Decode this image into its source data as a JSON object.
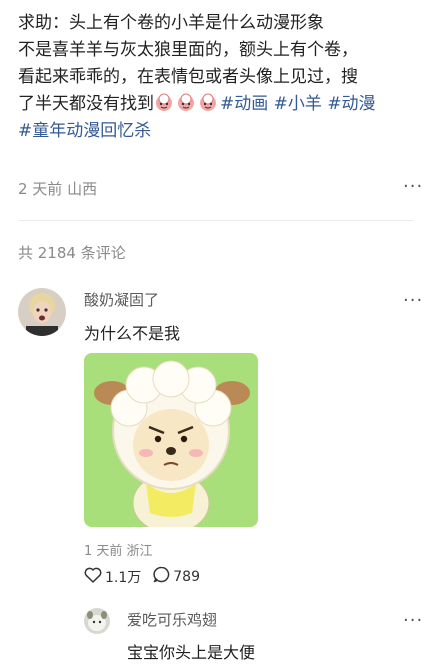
{
  "post": {
    "text": "求助：头上有个卷的小羊是什么动漫形象不是喜羊羊与灰太狼里面的，额头上有个卷，看起来乖乖的，在表情包或者头像上见过，搜了半天都没有找到",
    "line1": "求助：头上有个卷的小羊是什么动漫形象",
    "line2": "不是喜羊羊与灰太狼里面的，额头上有个卷，",
    "line3": "看起来乖乖的，在表情包或者头像上见过，搜",
    "line4_prefix": "了半天都没有找到",
    "emoji_count": 3,
    "tags": [
      "#动画",
      "#小羊",
      "#动漫",
      "#童年动漫回忆杀"
    ],
    "time": "2 天前",
    "location": "山西"
  },
  "comments_count_label": "共 2184 条评论",
  "comments": [
    {
      "username": "酸奶凝固了",
      "text": "为什么不是我",
      "time": "1 天前",
      "location": "浙江",
      "likes": "1.1万",
      "replies": "789",
      "reply": {
        "username": "爱吃可乐鸡翅",
        "text": "宝宝你头上是大便"
      }
    }
  ],
  "icons": [
    "more-icon",
    "heart-icon",
    "comment-icon",
    "emoji-icon"
  ],
  "colors": {
    "tag": "#345a95",
    "meta": "#8a8a8a",
    "image_bg": "#9fdc6f"
  }
}
